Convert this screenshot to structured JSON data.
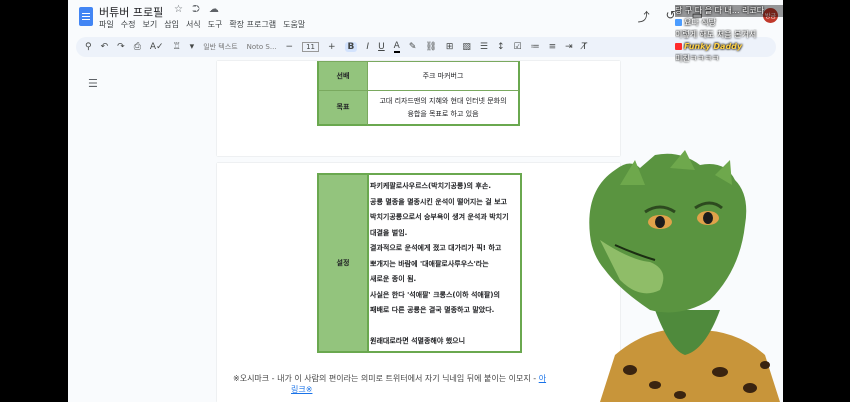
{
  "doc": {
    "title": "버튜버 프로필",
    "title_icons": "☆ ⮊ ☁",
    "menu": [
      "파일",
      "수정",
      "보기",
      "삽입",
      "서식",
      "도구",
      "확장 프로그램",
      "도움말"
    ]
  },
  "toolbar": {
    "style_select": "일반 텍스트",
    "font_select": "Noto S...",
    "font_size": "11",
    "bold": "B",
    "italic": "I",
    "underline": "U",
    "text_color": "A"
  },
  "table1": {
    "row1_label": "선배",
    "row1_value": "주크 마커버그",
    "row2_label": "목표",
    "row2_value_line1": "고대 리자드맨의 지혜와 현대 인터넷 문화의",
    "row2_value_line2": "융합을 목표로 하고 있음"
  },
  "table2": {
    "label": "설정",
    "lines": [
      "파키케팔로사우르스(박치기공룡)의 후손.",
      "공룡 멸종을 멸종시킨 운석이 떨어지는 걸 보고",
      "박치기공룡으로서 승부욕이 생겨 운석과 박치기",
      "대결을 벌임.",
      "결과적으로 운석에게 졌고 대가리가 픽! 하고",
      "뽀개지는 바람에 '대애팔로사루우스'라는",
      "새로운 종이 됨.",
      "사실은 한다 '석애팔' 크롱스(이하 석애팔)의",
      "패배로 다른 공룡은 결국 멸종하고 말았다.",
      "",
      "원래대로라면 석멸종해야 했으니"
    ]
  },
  "footer_note": {
    "text": "※오시마크 - 내가 이 사람의 편이라는 의미로 트위터에서 자기 닉네임 뒤에 붙이는 이모지 -",
    "link1": "아",
    "link2": "링크※"
  },
  "overlay": {
    "row1": "당 구 다 을 다 내... 리코다",
    "row2": "요다 식당",
    "row3": "이렇게 해도 처음 본거서",
    "name": "Funky Daddy",
    "row5": "미친ㅋㅋㅋㅋ"
  },
  "avatar_initial": "방금",
  "colors": {
    "table_head": "#93c47d",
    "table_border": "#6aa84f",
    "link": "#1a73e8",
    "docs_blue": "#4285f4"
  }
}
